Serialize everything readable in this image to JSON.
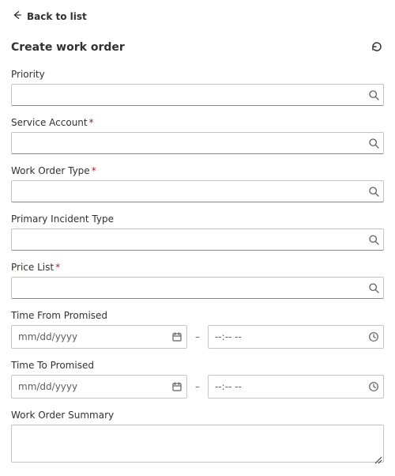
{
  "nav": {
    "back_label": "Back to list"
  },
  "page": {
    "title": "Create work order"
  },
  "fields": {
    "priority": {
      "label": "Priority",
      "value": "",
      "placeholder": ""
    },
    "service_account": {
      "label": "Service Account",
      "required_mark": "*",
      "value": "",
      "placeholder": ""
    },
    "work_order_type": {
      "label": "Work Order Type",
      "required_mark": "*",
      "value": "",
      "placeholder": ""
    },
    "primary_incident_type": {
      "label": "Primary Incident Type",
      "value": "",
      "placeholder": ""
    },
    "price_list": {
      "label": "Price List",
      "required_mark": "*",
      "value": "",
      "placeholder": ""
    },
    "time_from": {
      "label": "Time From Promised",
      "date_placeholder": "mm/dd/yyyy",
      "date_value": "",
      "time_placeholder": "--:-- --",
      "time_value": "",
      "separator": "–"
    },
    "time_to": {
      "label": "Time To Promised",
      "date_placeholder": "mm/dd/yyyy",
      "date_value": "",
      "time_placeholder": "--:-- --",
      "time_value": "",
      "separator": "–"
    },
    "work_order_summary": {
      "label": "Work Order Summary",
      "value": "",
      "placeholder": ""
    }
  }
}
